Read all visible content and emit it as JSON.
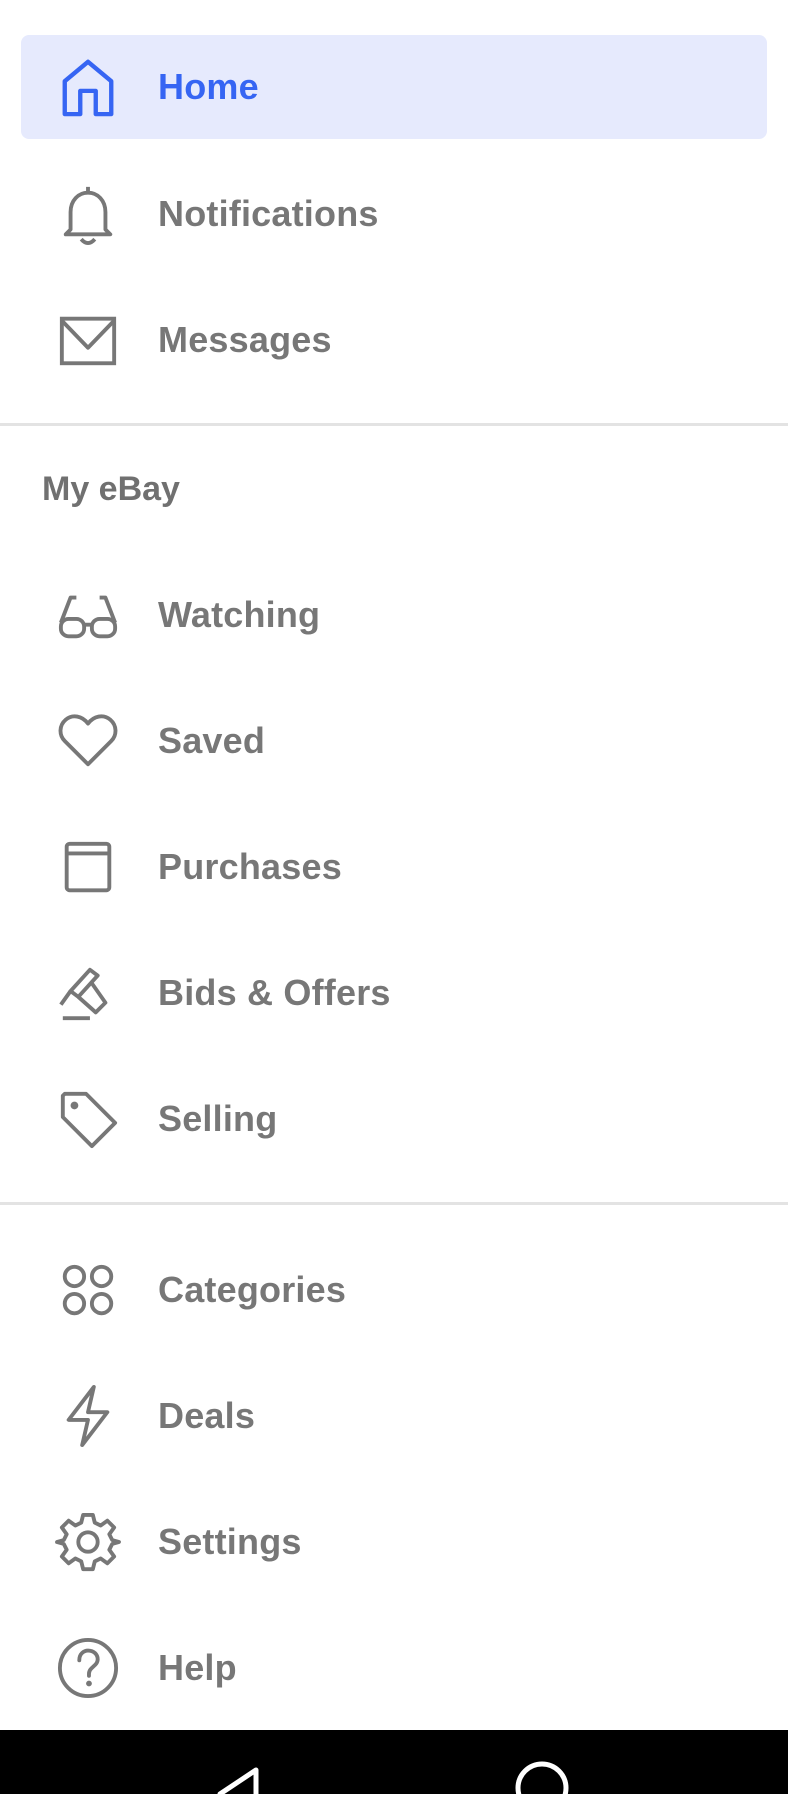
{
  "drawer": {
    "top_items": [
      {
        "label": "Home",
        "icon": "home-icon",
        "active": true
      },
      {
        "label": "Notifications",
        "icon": "bell-icon"
      },
      {
        "label": "Messages",
        "icon": "envelope-icon"
      }
    ],
    "my_ebay": {
      "title": "My eBay",
      "items": [
        {
          "label": "Watching",
          "icon": "glasses-icon"
        },
        {
          "label": "Saved",
          "icon": "heart-icon"
        },
        {
          "label": "Purchases",
          "icon": "box-icon"
        },
        {
          "label": "Bids & Offers",
          "icon": "gavel-icon"
        },
        {
          "label": "Selling",
          "icon": "tag-icon"
        }
      ]
    },
    "bottom_items": [
      {
        "label": "Categories",
        "icon": "categories-icon"
      },
      {
        "label": "Deals",
        "icon": "lightning-icon"
      },
      {
        "label": "Settings",
        "icon": "gear-icon"
      },
      {
        "label": "Help",
        "icon": "help-icon"
      }
    ]
  },
  "system_nav": {
    "buttons": [
      "back-icon",
      "home-circle-icon"
    ]
  },
  "colors": {
    "accent": "#3665f3",
    "active_bg": "#e6eafd",
    "text": "#777777",
    "divider": "#e3e3e3"
  }
}
